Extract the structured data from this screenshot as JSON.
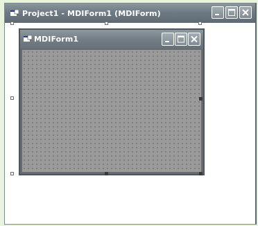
{
  "outer_window": {
    "title": "Project1 - MDIForm1 (MDIForm)",
    "icon": "form-icon",
    "buttons": [
      "minimize-icon",
      "maximize-icon",
      "close-icon"
    ]
  },
  "child_form": {
    "title": "MDIForm1",
    "icon": "form-icon",
    "buttons": [
      "minimize-icon",
      "maximize-icon",
      "close-icon"
    ]
  },
  "colors": {
    "page_background": "#e9f4dc",
    "titlebar": "#6f7b84",
    "client_area": "#9a9a9a",
    "grid_dots": "#707070"
  }
}
